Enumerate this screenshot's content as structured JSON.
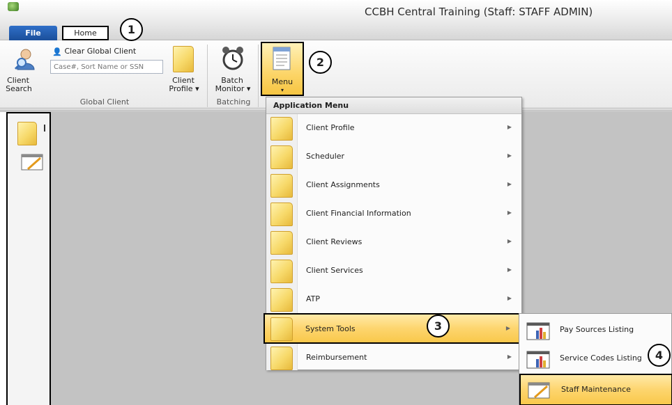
{
  "window": {
    "title": "CCBH Central Training (Staff: STAFF ADMIN)"
  },
  "tabs": {
    "file": "File",
    "home": "Home"
  },
  "callouts": [
    "1",
    "2",
    "3",
    "4"
  ],
  "ribbon": {
    "global_client": {
      "group_label": "Global Client",
      "client_search_line1": "Client",
      "client_search_line2": "Search",
      "clear_global_client": "Clear Global Client",
      "search_placeholder": "Case#, Sort Name or SSN",
      "client_profile_line1": "Client",
      "client_profile_line2": "Profile ▾"
    },
    "batching": {
      "group_label": "Batching",
      "batch_monitor_line1": "Batch",
      "batch_monitor_line2": "Monitor ▾"
    },
    "menu": {
      "label": "Menu",
      "arrow": "▾"
    }
  },
  "application_menu": {
    "header": "Application Menu",
    "items": [
      {
        "label": "Client Profile"
      },
      {
        "label": "Scheduler"
      },
      {
        "label": "Client Assignments"
      },
      {
        "label": "Client Financial Information"
      },
      {
        "label": "Client Reviews"
      },
      {
        "label": "Client Services"
      },
      {
        "label": "ATP"
      },
      {
        "label": "System Tools"
      },
      {
        "label": "Reimbursement"
      }
    ],
    "arrow": "▶"
  },
  "submenu": {
    "items": [
      {
        "label": "Pay Sources Listing"
      },
      {
        "label": "Service Codes Listing"
      },
      {
        "label": "Staff Maintenance"
      }
    ]
  },
  "colors": {
    "highlight": "#fdd56e",
    "file_tab": "#1b4f9a",
    "workarea": "#c3c3c3"
  }
}
